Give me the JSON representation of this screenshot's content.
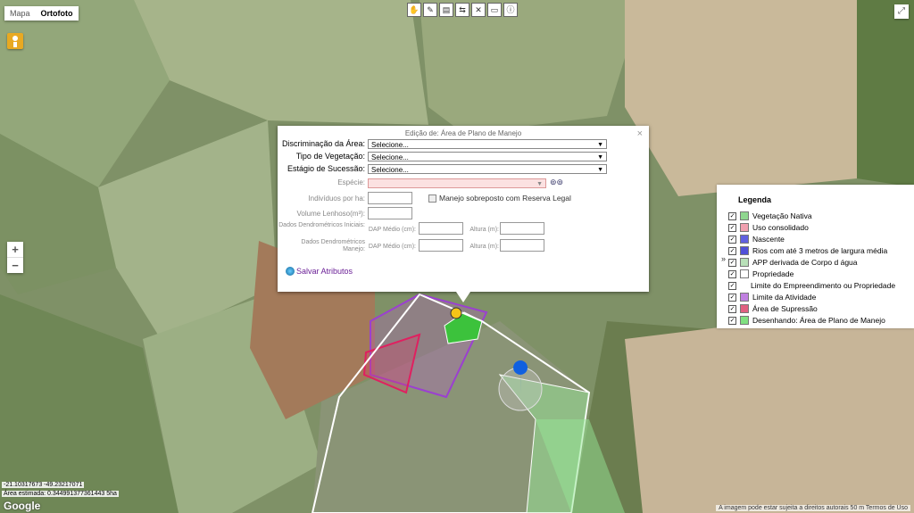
{
  "map": {
    "map_types": [
      "Mapa",
      "Ortofoto"
    ],
    "active_map_type": "Ortofoto",
    "zoom_in": "+",
    "zoom_out": "−",
    "fullscreen_icon": "fullscreen-icon",
    "coords": "-21.10317673 -49.23217071",
    "area": "Área estimada: 0.344991377361443 5ha",
    "google_logo": "Google",
    "attribution": "A imagem pode estar sujeita a direitos autorais  50 m   Termos de Uso"
  },
  "toolbar": {
    "icons": [
      "hand-icon",
      "draw-icon",
      "edit-icon",
      "split-icon",
      "delete-icon",
      "save-icon",
      "info-icon"
    ],
    "glyphs": [
      "✋",
      "✎",
      "▤",
      "⇆",
      "✕",
      "▭",
      "ⓘ"
    ]
  },
  "dialog": {
    "title": "Edição de: Área de Plano de Manejo",
    "close": "×",
    "fields": {
      "discriminacao_label": "Discriminação da Área:",
      "discriminacao_value": "Selecione...",
      "tipo_label": "Tipo de Vegetação:",
      "tipo_value": "Selecione...",
      "estagio_label": "Estágio de Sucessão:",
      "estagio_value": "Selecione...",
      "especie_label": "Espécie:",
      "individuos_label": "Indivíduos por ha:",
      "manejo_label": "Manejo sobreposto com Reserva Legal",
      "volume_label": "Volume Lenhoso(m³):",
      "dendro_iniciais_label": "Dados Dendrométricos Iniciais:",
      "dendro_manejo_label": "Dados Dendrométricos Manejo:",
      "dap_label": "DAP Médio (cm):",
      "altura_label": "Altura (m):"
    },
    "save_label": "Salvar Atributos"
  },
  "legend": {
    "title": "Legenda",
    "toggle": "»",
    "items": [
      {
        "label": "Vegetação Nativa",
        "color": "#8fd68f"
      },
      {
        "label": "Uso consolidado",
        "color": "#f0a0b0"
      },
      {
        "label": "Nascente",
        "color": "#6060e0"
      },
      {
        "label": "Rios com até 3 metros de largura média",
        "color": "#5050d8"
      },
      {
        "label": "APP derivada de Corpo d água",
        "color": "#b8e0b8"
      },
      {
        "label": "Propriedade",
        "color": "#ffffff"
      },
      {
        "label": "Limite do Empreendimento ou Propriedade",
        "color": ""
      },
      {
        "label": "Limite da Atividade",
        "color": "#c080e0"
      },
      {
        "label": "Área de Supressão",
        "color": "#e06080"
      },
      {
        "label": "Desenhando: Área de Plano de Manejo",
        "color": "#80e080"
      }
    ]
  }
}
